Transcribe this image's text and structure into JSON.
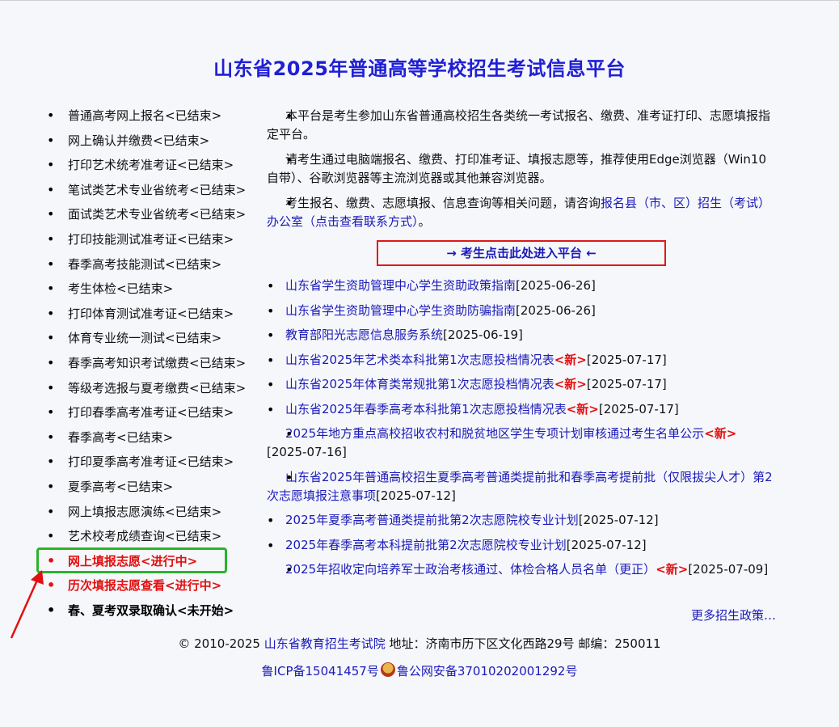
{
  "title": "山东省2025年普通高等学校招生考试信息平台",
  "left_menu": [
    {
      "label": "普通高考网上报名<已结束>",
      "style": "normal"
    },
    {
      "label": "网上确认并缴费<已结束>",
      "style": "normal"
    },
    {
      "label": "打印艺术统考准考证<已结束>",
      "style": "normal"
    },
    {
      "label": "笔试类艺术专业省统考<已结束>",
      "style": "normal"
    },
    {
      "label": "面试类艺术专业省统考<已结束>",
      "style": "normal"
    },
    {
      "label": "打印技能测试准考证<已结束>",
      "style": "normal"
    },
    {
      "label": "春季高考技能测试<已结束>",
      "style": "normal"
    },
    {
      "label": "考生体检<已结束>",
      "style": "normal"
    },
    {
      "label": "打印体育测试准考证<已结束>",
      "style": "normal"
    },
    {
      "label": "体育专业统一测试<已结束>",
      "style": "normal"
    },
    {
      "label": "春季高考知识考试缴费<已结束>",
      "style": "normal"
    },
    {
      "label": "等级考选报与夏考缴费<已结束>",
      "style": "normal"
    },
    {
      "label": "打印春季高考准考证<已结束>",
      "style": "normal"
    },
    {
      "label": "春季高考<已结束>",
      "style": "normal"
    },
    {
      "label": "打印夏季高考准考证<已结束>",
      "style": "normal"
    },
    {
      "label": "夏季高考<已结束>",
      "style": "normal"
    },
    {
      "label": "网上填报志愿演练<已结束>",
      "style": "normal"
    },
    {
      "label": "艺术校考成绩查询<已结束>",
      "style": "normal"
    },
    {
      "label": "网上填报志愿<进行中>",
      "style": "red"
    },
    {
      "label": "历次填报志愿查看<进行中>",
      "style": "red"
    },
    {
      "label": "春、夏考双录取确认<未开始>",
      "style": "bold"
    }
  ],
  "intro": {
    "p1": "本平台是考生参加山东省普通高校招生各类统一考试报名、缴费、准考证打印、志愿填报指定平台。",
    "p2": "请考生通过电脑端报名、缴费、打印准考证、填报志愿等，推荐使用Edge浏览器（Win10自带）、谷歌浏览器等主流浏览器或其他兼容浏览器。",
    "p3_text": "考生报名、缴费、志愿填报、信息查询等相关问题，请咨询",
    "p3_link": "报名县（市、区）招生（考试）办公室（点击查看联系方式）",
    "p3_end": "。"
  },
  "enter_button": "→ 考生点击此处进入平台 ←",
  "news": [
    {
      "title": "山东省学生资助管理中心学生资助政策指南",
      "new": "",
      "date": "[2025-06-26]"
    },
    {
      "title": "山东省学生资助管理中心学生资助防骗指南",
      "new": "",
      "date": "[2025-06-26]"
    },
    {
      "title": "教育部阳光志愿信息服务系统",
      "new": "",
      "date": "[2025-06-19]"
    },
    {
      "title": "山东省2025年艺术类本科批第1次志愿投档情况表",
      "new": "<新>",
      "date": "[2025-07-17]"
    },
    {
      "title": "山东省2025年体育类常规批第1次志愿投档情况表",
      "new": "<新>",
      "date": "[2025-07-17]"
    },
    {
      "title": "山东省2025年春季高考本科批第1次志愿投档情况表",
      "new": "<新>",
      "date": "[2025-07-17]"
    },
    {
      "title": "2025年地方重点高校招收农村和脱贫地区学生专项计划审核通过考生名单公示",
      "new": "<新>",
      "date": "[2025-07-16]"
    },
    {
      "title": "山东省2025年普通高校招生夏季高考普通类提前批和春季高考提前批（仅限拔尖人才）第2次志愿填报注意事项",
      "new": "",
      "date": "[2025-07-12]"
    },
    {
      "title": "2025年夏季高考普通类提前批第2次志愿院校专业计划",
      "new": "",
      "date": "[2025-07-12]"
    },
    {
      "title": "2025年春季高考本科提前批第2次志愿院校专业计划",
      "new": "",
      "date": "[2025-07-12]"
    },
    {
      "title": "2025年招收定向培养军士政治考核通过、体检合格人员名单（更正）",
      "new": "<新>",
      "date": "[2025-07-09]"
    }
  ],
  "more": "更多招生政策…",
  "footer": {
    "copyright": "© 2010-2025",
    "org": "山东省教育招生考试院",
    "address": "地址：济南市历下区文化西路29号 邮编：250011",
    "icp": "鲁ICP备15041457号",
    "police": "鲁公网安备37010202001292号"
  },
  "colors": {
    "link": "#1a1ab8",
    "title": "#1f1fd6",
    "active": "#e21010",
    "highlight_box": "#2bb32b",
    "enter_border": "#e01818"
  }
}
